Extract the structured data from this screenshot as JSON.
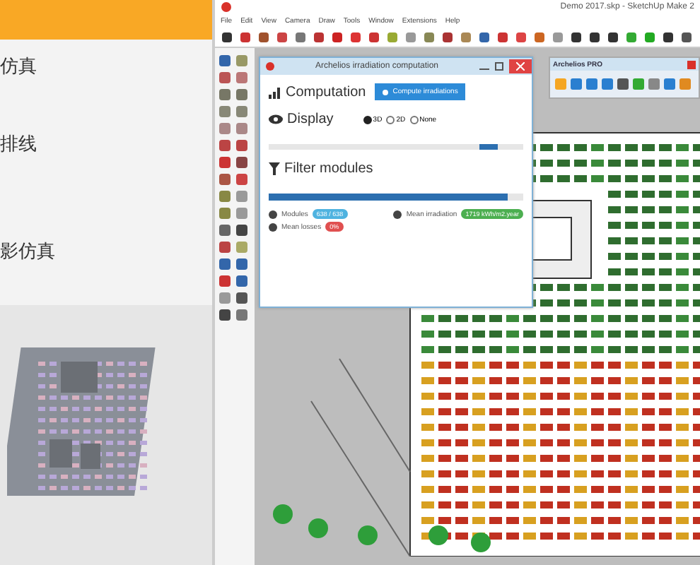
{
  "left_panel": {
    "items": [
      "仿真",
      "排线",
      "影仿真"
    ]
  },
  "window": {
    "title": "Demo 2017.skp - SketchUp Make 2"
  },
  "menu": [
    "File",
    "Edit",
    "View",
    "Camera",
    "Draw",
    "Tools",
    "Window",
    "Extensions",
    "Help"
  ],
  "dialog": {
    "title": "Archelios irradiation computation",
    "computation": {
      "heading": "Computation",
      "button": "Compute irradiations"
    },
    "display": {
      "heading": "Display",
      "options": [
        {
          "label": "3D",
          "selected": true
        },
        {
          "label": "2D",
          "selected": false
        },
        {
          "label": "None",
          "selected": false
        }
      ],
      "level": 0.9
    },
    "filter": {
      "heading": "Filter modules",
      "level": 0.94,
      "stats": [
        {
          "label": "Modules",
          "value": "638 / 638",
          "color": "#4fb3e0"
        },
        {
          "label": "Mean irradiation",
          "value": "1719 kWh/m2.year",
          "color": "#4caf50"
        },
        {
          "label": "Mean losses",
          "value": "0%",
          "color": "#e05050"
        }
      ]
    }
  },
  "pro_panel": {
    "title": "Archelios PRO"
  }
}
